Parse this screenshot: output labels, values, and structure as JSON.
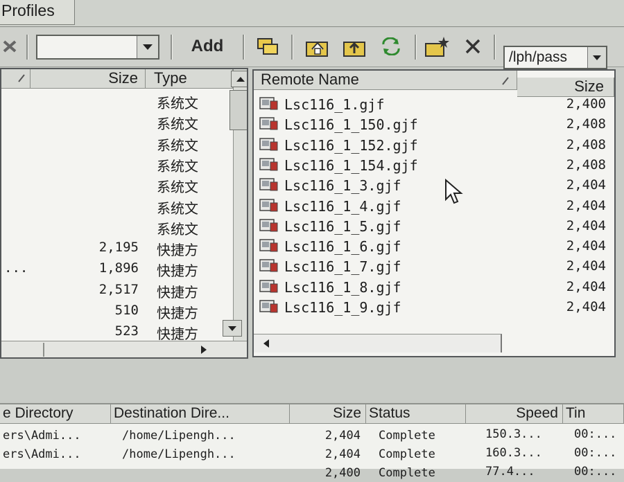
{
  "tab": {
    "label": "Profiles"
  },
  "toolbar": {
    "add_label": "Add",
    "profile_combo_value": "",
    "remote_path": "/lph/pass"
  },
  "local": {
    "columns": {
      "name": "",
      "size": "Size",
      "type": "Type"
    },
    "rows": [
      {
        "name": "",
        "size": "",
        "type": "系统文"
      },
      {
        "name": "",
        "size": "",
        "type": "系统文"
      },
      {
        "name": "",
        "size": "",
        "type": "系统文"
      },
      {
        "name": "",
        "size": "",
        "type": "系统文"
      },
      {
        "name": "",
        "size": "",
        "type": "系统文"
      },
      {
        "name": "",
        "size": "",
        "type": "系统文"
      },
      {
        "name": "",
        "size": "",
        "type": "系统文"
      },
      {
        "name": "",
        "size": "2,195",
        "type": "快捷方"
      },
      {
        "name": "...",
        "size": "1,896",
        "type": "快捷方"
      },
      {
        "name": "",
        "size": "2,517",
        "type": "快捷方"
      },
      {
        "name": "",
        "size": "510",
        "type": "快捷方"
      },
      {
        "name": "",
        "size": "523",
        "type": "快捷方"
      }
    ]
  },
  "remote": {
    "columns": {
      "name": "Remote Name",
      "size": "Size"
    },
    "rows": [
      {
        "name": "Lsc116_1.gjf",
        "size": "2,400"
      },
      {
        "name": "Lsc116_1_150.gjf",
        "size": "2,408"
      },
      {
        "name": "Lsc116_1_152.gjf",
        "size": "2,408"
      },
      {
        "name": "Lsc116_1_154.gjf",
        "size": "2,408"
      },
      {
        "name": "Lsc116_1_3.gjf",
        "size": "2,404"
      },
      {
        "name": "Lsc116_1_4.gjf",
        "size": "2,404"
      },
      {
        "name": "Lsc116_1_5.gjf",
        "size": "2,404"
      },
      {
        "name": "Lsc116_1_6.gjf",
        "size": "2,404"
      },
      {
        "name": "Lsc116_1_7.gjf",
        "size": "2,404"
      },
      {
        "name": "Lsc116_1_8.gjf",
        "size": "2,404"
      },
      {
        "name": "Lsc116_1_9.gjf",
        "size": "2,404"
      }
    ]
  },
  "queue": {
    "columns": {
      "source": "e Directory",
      "dest": "Destination Dire...",
      "size": "Size",
      "status": "Status",
      "speed": "Speed",
      "time": "Tin"
    },
    "rows": [
      {
        "source": "ers\\Admi...",
        "dest": "/home/Lipengh...",
        "size": "2,404",
        "status": "Complete",
        "speed": "150.3...",
        "time": "00:..."
      },
      {
        "source": "ers\\Admi...",
        "dest": "/home/Lipengh...",
        "size": "2,404",
        "status": "Complete",
        "speed": "160.3...",
        "time": "00:..."
      },
      {
        "source": "",
        "dest": "",
        "size": "2,400",
        "status": "Complete",
        "speed": "77.4...",
        "time": "00:..."
      }
    ]
  },
  "colors": {
    "panel_bg": "#f4f4f1",
    "chrome_bg": "#c9ccc7",
    "icon_red": "#b8342e"
  }
}
